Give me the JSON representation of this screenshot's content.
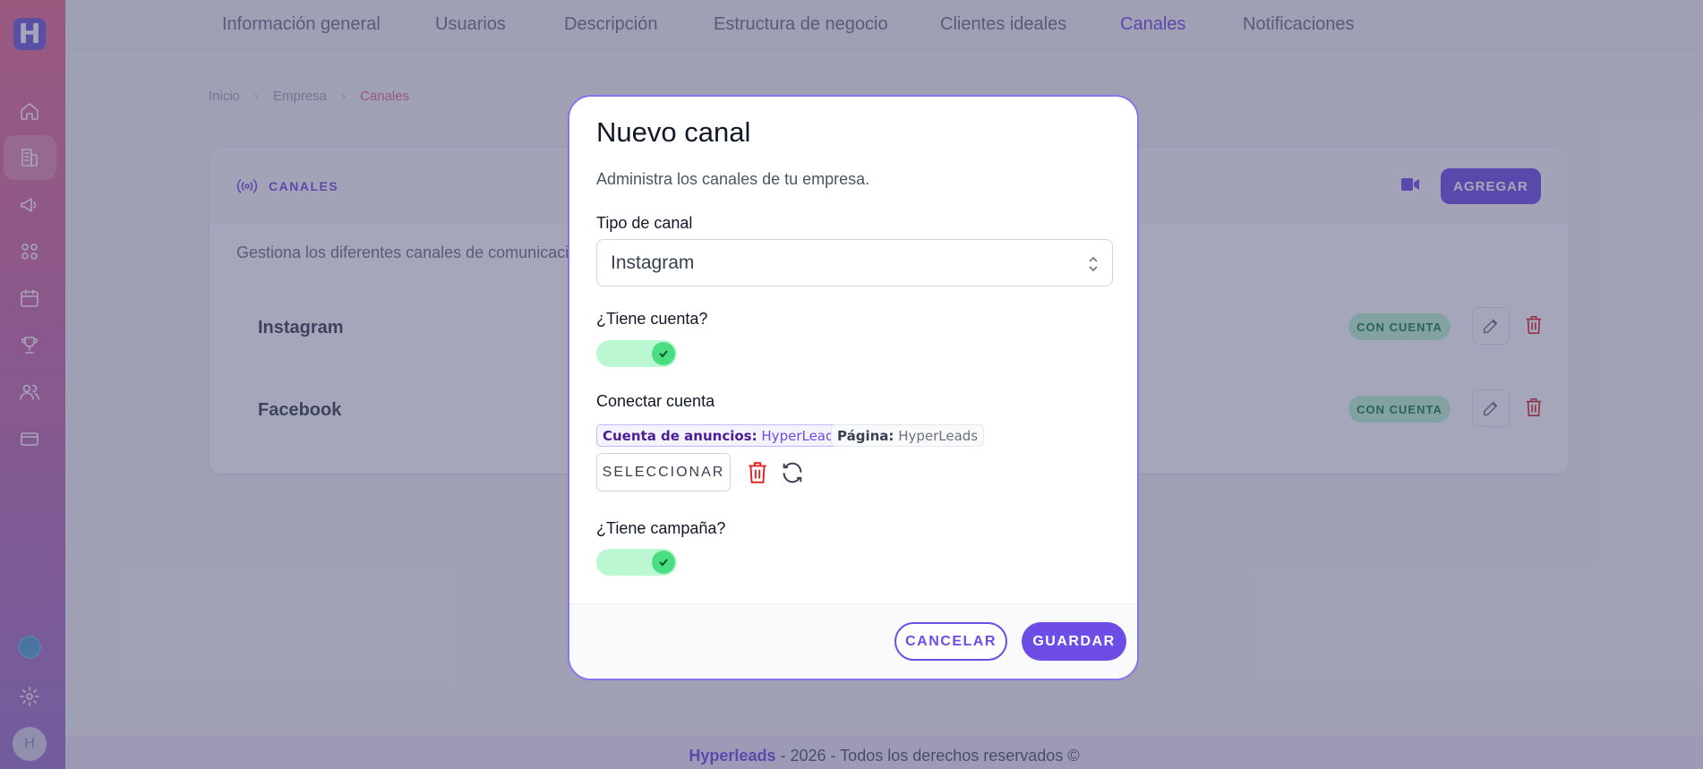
{
  "app": {
    "logo_letter": "H",
    "user_initial": "H"
  },
  "tabs": [
    {
      "label": "Información general"
    },
    {
      "label": "Usuarios"
    },
    {
      "label": "Descripción"
    },
    {
      "label": "Estructura de negocio"
    },
    {
      "label": "Clientes ideales"
    },
    {
      "label": "Canales",
      "active": true
    },
    {
      "label": "Notificaciones"
    }
  ],
  "breadcrumb": [
    "Inicio",
    "Empresa",
    "Canales"
  ],
  "channels_card": {
    "title": "CANALES",
    "add_label": "AGREGAR",
    "description": "Gestiona los diferentes canales de comunicación y",
    "rows": [
      {
        "name": "Instagram",
        "status": "CON CUENTA"
      },
      {
        "name": "Facebook",
        "status": "CON CUENTA"
      }
    ]
  },
  "footer": {
    "brand": "Hyperleads",
    "text": " - 2026 - Todos los derechos reservados ©"
  },
  "modal": {
    "title": "Nuevo canal",
    "subtitle": "Administra los canales de tu empresa.",
    "channel_type_label": "Tipo de canal",
    "channel_type_value": "Instagram",
    "has_account_label": "¿Tiene cuenta?",
    "has_account": true,
    "connect_label": "Conectar cuenta",
    "ads_account_key": "Cuenta de anuncios:",
    "ads_account_value": "HyperLeads",
    "page_key": "Página:",
    "page_value": "HyperLeads",
    "select_label": "SELECCIONAR",
    "has_campaign_label": "¿Tiene campaña?",
    "has_campaign": true,
    "cancel_label": "CANCELAR",
    "save_label": "GUARDAR"
  },
  "colors": {
    "accent": "#6d4de6",
    "success_bg": "#bbf7d0",
    "danger": "#dc2626"
  }
}
